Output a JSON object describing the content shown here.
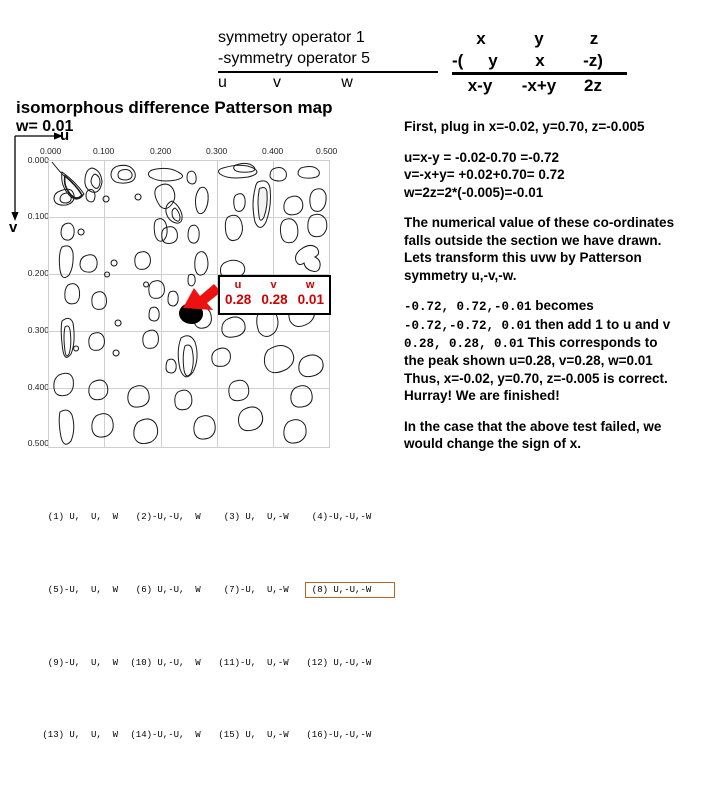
{
  "formula": {
    "left": {
      "line1": "symmetry operator 1",
      "line2": "-symmetry operator 5",
      "result": [
        "u",
        "v",
        "w"
      ]
    },
    "right": {
      "line1": [
        "x",
        "y",
        "z"
      ],
      "line2": [
        "-(",
        "y",
        "x",
        "-z)"
      ],
      "result": [
        "x-y",
        "-x+y",
        "2z"
      ]
    }
  },
  "explain": {
    "p1": "First, plug in x=-0.02, y=0.70, z=-0.005",
    "p2_l1": "u=x-y  = -0.02-0.70 =-0.72",
    "p2_l2": "v=-x+y= +0.02+0.70= 0.72",
    "p2_l3": "w=2z=2*(-0.005)=-0.01",
    "p3_l1": "The numerical value of these co-ordinates",
    "p3_l2": "falls outside the section we have drawn.",
    "p3_l3": "Lets transform this uvw by Patterson",
    "p3_l4": "symmetry u,-v,-w.",
    "p4_l1_mono": "-0.72, 0.72,-0.01",
    "p4_l1_text": " becomes",
    "p4_l2_mono": "-0.72,-0.72, 0.01",
    "p4_l2_text": " then add 1 to u and v",
    "p4_l3_mono": " 0.28, 0.28, 0.01",
    "p4_l3_text": " This corresponds to",
    "p4_l4": "the peak shown u=0.28, v=0.28, w=0.01",
    "p4_l5": "Thus, x=-0.02, y=0.70, z=-0.005 is correct.",
    "p4_l6": "Hurray! We are finished!",
    "p5_l1": "In the case that the above test failed, we",
    "p5_l2": "would change the sign of x."
  },
  "map": {
    "title": "isomorphous difference Patterson map",
    "subtitle": "w= 0.01",
    "u_axis_label": "u",
    "v_axis_label": "v",
    "x_ticks": [
      "0.000",
      "0.100",
      "0.200",
      "0.300",
      "0.400",
      "0.500"
    ],
    "y_ticks": [
      "0.000",
      "0.100",
      "0.200",
      "0.300",
      "0.400",
      "0.500"
    ],
    "origin_tick": "0.000",
    "callout": {
      "headers": [
        "u",
        "v",
        "w"
      ],
      "values": [
        "0.28",
        "0.28",
        "0.01"
      ],
      "text_color": "#d00000"
    }
  },
  "symops": {
    "rows": [
      [
        " (1) U,  U,  W",
        " (2)-U,-U,  W",
        " (3) U,  U,-W",
        " (4)-U,-U,-W"
      ],
      [
        " (5)-U,  U,  W",
        " (6) U,-U,  W",
        " (7)-U,  U,-W",
        " (8) U,-U,-W"
      ],
      [
        " (9)-U,  U,  W",
        "(10) U,-U,  W",
        "(11)-U,  U,-W",
        "(12) U,-U,-W"
      ],
      [
        "(13) U,  U,  W",
        "(14)-U,-U,  W",
        "(15) U,  U,-W",
        "(16)-U,-U,-W"
      ]
    ],
    "highlighted": "(8) U,-U,-W",
    "highlight_color": "#b5651d"
  }
}
